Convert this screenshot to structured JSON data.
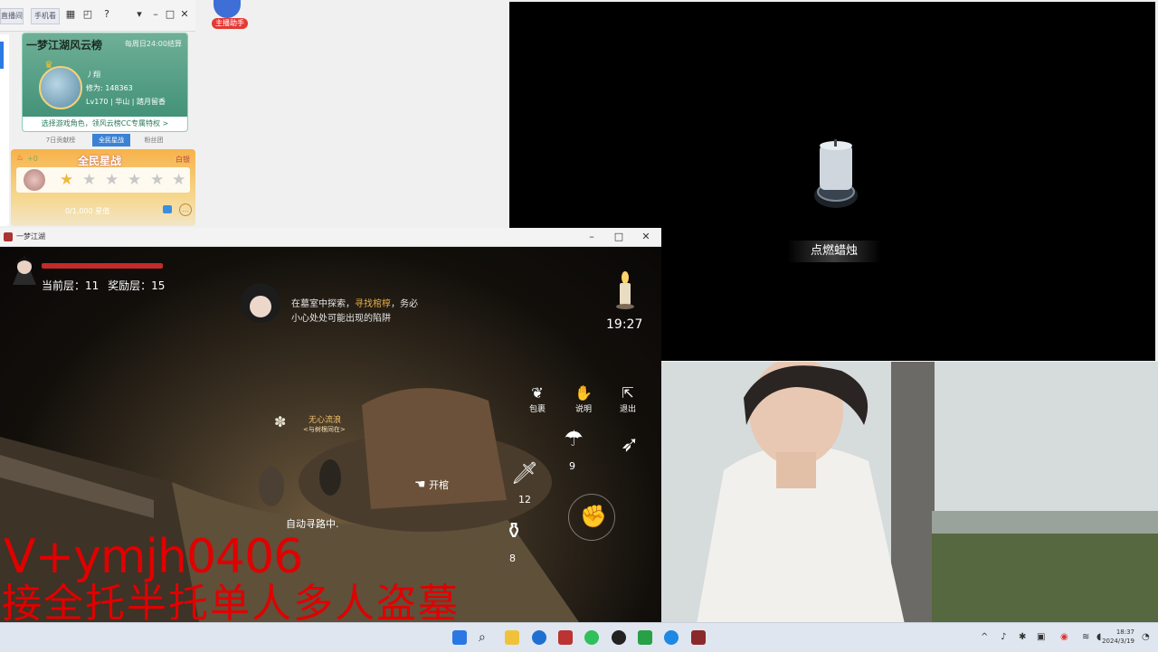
{
  "desktop_app": {
    "top_tabs": [
      "直播间",
      "手机看"
    ],
    "assistant_label": "主播助手"
  },
  "rank_card": {
    "title": "一梦江湖风云榜",
    "schedule": "每周日24:00结算",
    "player_name": "丿翔",
    "power": "修为: 148363",
    "level_line": "Lv170 | 华山 | 踏月留香",
    "cta": "选择游戏角色，领风云榜CC专属特权 >",
    "tabs": [
      "7日贡献榜",
      "全民星战",
      "粉丝团"
    ],
    "active_tab": 1
  },
  "star_card": {
    "increment": "+0",
    "title": "全民星战",
    "close_label": "白银",
    "stars_total": 6,
    "stars_lit": 1,
    "progress_text": "0/1,000 星值"
  },
  "candle_panel": {
    "action_label": "点燃蜡烛"
  },
  "game_window": {
    "title": "一梦江湖",
    "floor_label": "当前层：11",
    "reward_label": "奖励层：15",
    "hint_prefix": "在墓室中探索，",
    "hint_highlight": "寻找棺椁",
    "hint_suffix": "，务必",
    "hint_line2": "小心处处可能出现的陷阱",
    "timer": "19:27",
    "tools": [
      {
        "label": "包裹"
      },
      {
        "label": "说明"
      },
      {
        "label": "退出"
      }
    ],
    "guild_name": "无心流浪",
    "guild_sub": "<与树根同在>",
    "open_hint": "开棺",
    "auto_path": "自动寻路中.",
    "counts": {
      "umbrella": "9",
      "dagger": "12",
      "gourd": "8"
    }
  },
  "watermark": {
    "line1": "V+ymjh0406",
    "line2": "接全托半托单人多人盗墓"
  },
  "taskbar": {
    "clock_time": "18:37",
    "clock_date": "2024/3/19"
  },
  "colors": {
    "accent_red": "#e00000",
    "rank_green": "#3c8d74",
    "tab_blue": "#3b82d6",
    "hint_gold": "#e5b04a"
  }
}
